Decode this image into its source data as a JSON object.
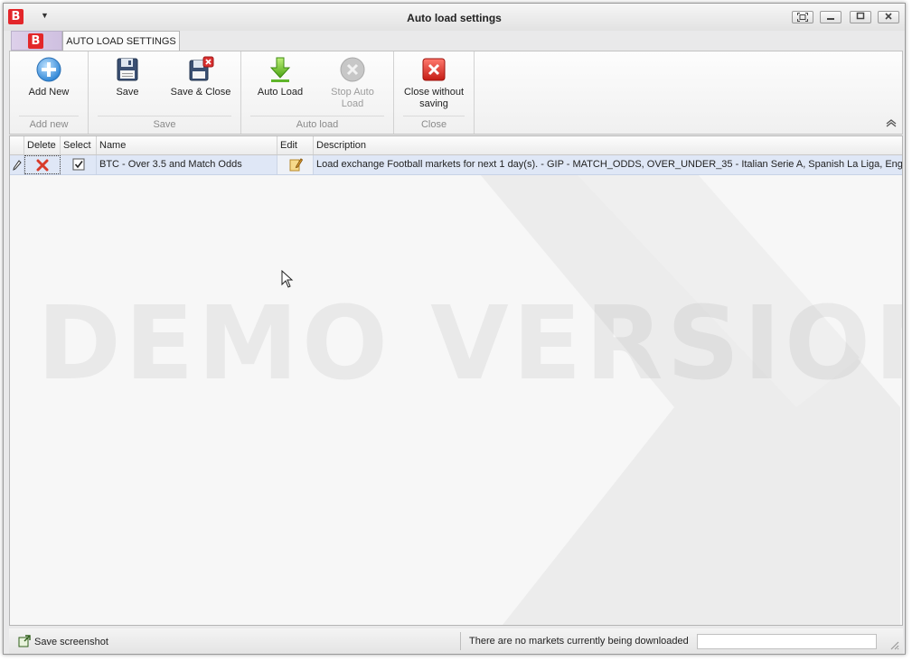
{
  "window": {
    "title": "Auto load settings",
    "logo_letter": "B"
  },
  "tabs": [
    {
      "label": "AUTO LOAD SETTINGS",
      "active": true
    }
  ],
  "ribbon": {
    "groups": [
      {
        "caption": "Add new",
        "buttons": [
          {
            "label": "Add New",
            "icon": "add-circle-icon",
            "enabled": true
          }
        ]
      },
      {
        "caption": "Save",
        "buttons": [
          {
            "label": "Save",
            "icon": "floppy-disk-icon",
            "enabled": true
          },
          {
            "label": "Save & Close",
            "icon": "floppy-disk-close-icon",
            "enabled": true
          }
        ]
      },
      {
        "caption": "Auto load",
        "buttons": [
          {
            "label": "Auto Load",
            "icon": "download-arrow-icon",
            "enabled": true
          },
          {
            "label": "Stop Auto Load",
            "icon": "stop-circle-icon",
            "enabled": false
          }
        ]
      },
      {
        "caption": "Close",
        "buttons": [
          {
            "label": "Close without saving",
            "icon": "red-x-icon",
            "enabled": true
          }
        ]
      }
    ]
  },
  "grid": {
    "columns": [
      "Delete",
      "Select",
      "Name",
      "Edit",
      "Description"
    ],
    "rows": [
      {
        "selected": true,
        "name": "BTC - Over 3.5 and Match Odds",
        "description": "Load  exchange Football markets for next 1 day(s). - GIP - MATCH_ODDS, OVER_UNDER_35 - Italian Serie A, Spanish La Liga, Englis..."
      }
    ],
    "watermark": "DEMO VERSION"
  },
  "statusbar": {
    "save_screenshot": "Save screenshot",
    "message": "There are no markets currently being downloaded"
  },
  "colors": {
    "accent_red": "#e3262a",
    "row_selected": "#dfe7f6"
  }
}
